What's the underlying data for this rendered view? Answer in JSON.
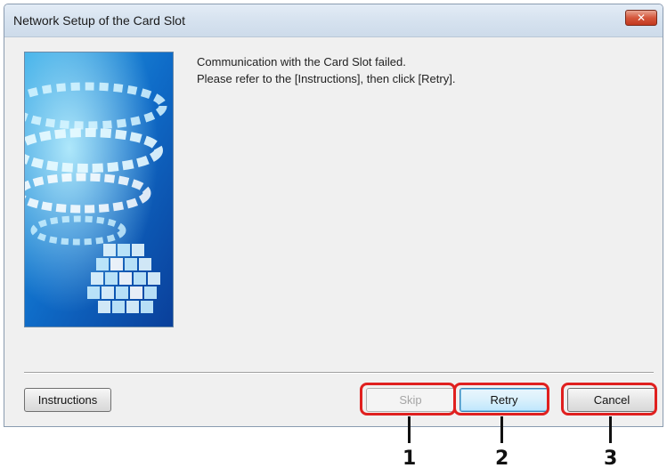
{
  "window": {
    "title": "Network Setup of the Card Slot",
    "close_glyph": "✕"
  },
  "message": {
    "line1": "Communication with the Card Slot failed.",
    "line2": "Please refer to the [Instructions], then click [Retry]."
  },
  "buttons": {
    "instructions": "Instructions",
    "skip": "Skip",
    "retry": "Retry",
    "cancel": "Cancel"
  },
  "callouts": [
    "1",
    "2",
    "3"
  ],
  "colors": {
    "highlight": "#e0201f",
    "image_blue": "#0b5bb8"
  }
}
